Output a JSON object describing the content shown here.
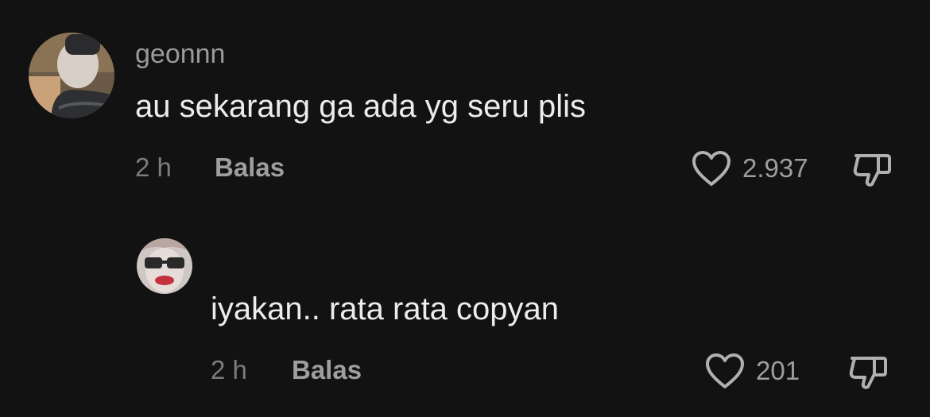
{
  "comments": [
    {
      "username": "geonnn",
      "text": "au sekarang ga ada yg seru plis",
      "time": "2 h",
      "reply_label": "Balas",
      "likes": "2.937"
    },
    {
      "username": "",
      "text": "iyakan.. rata rata copyan",
      "time": "2 h",
      "reply_label": "Balas",
      "likes": "201"
    }
  ],
  "icons": {
    "like": "heart-outline-icon",
    "dislike": "thumbs-down-outline-icon"
  },
  "colors": {
    "background": "#121212",
    "text": "#ececec",
    "muted": "#9a9a9a"
  }
}
